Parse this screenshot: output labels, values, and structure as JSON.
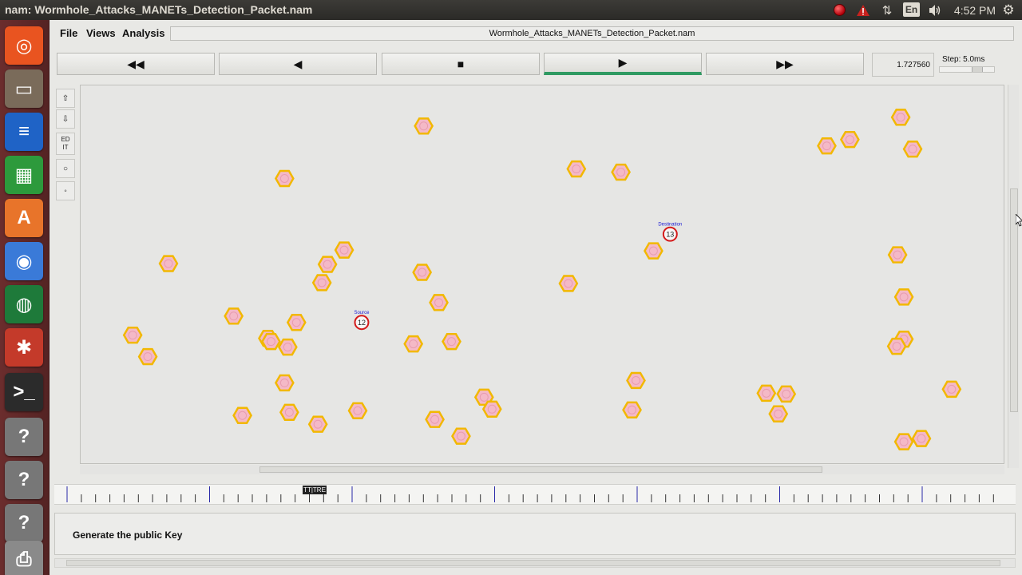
{
  "window": {
    "title": "nam: Wormhole_Attacks_MANETs_Detection_Packet.nam"
  },
  "tray": {
    "lang": "En",
    "clock": "4:52 PM",
    "recording_color": "#c4000e"
  },
  "launcher": {
    "items": [
      {
        "name": "ubuntu-dash-icon",
        "glyph": "◎",
        "color": "#e95420"
      },
      {
        "name": "files-icon",
        "glyph": "▭",
        "color": "#7a6b5a"
      },
      {
        "name": "writer-icon",
        "glyph": "≡",
        "color": "#1f63c6"
      },
      {
        "name": "calc-icon",
        "glyph": "▦",
        "color": "#2d9a3c"
      },
      {
        "name": "software-center-icon",
        "glyph": "A",
        "color": "#e8742a"
      },
      {
        "name": "chromium-icon",
        "glyph": "◉",
        "color": "#3a7ad8"
      },
      {
        "name": "globe-icon",
        "glyph": "◍",
        "color": "#1e7a3a"
      },
      {
        "name": "settings-icon",
        "glyph": "✱",
        "color": "#c43a2a"
      },
      {
        "name": "terminal-icon",
        "glyph": ">_",
        "color": "#2b2b2b"
      },
      {
        "name": "unknown-app-icon",
        "glyph": "?",
        "color": "#777777"
      },
      {
        "name": "unknown-app-icon",
        "glyph": "?",
        "color": "#777777"
      },
      {
        "name": "unknown-app-icon",
        "glyph": "?",
        "color": "#777777"
      },
      {
        "name": "printer-icon",
        "glyph": "⎙",
        "color": "#8a8a8a"
      }
    ]
  },
  "menu": {
    "file": "File",
    "views": "Views",
    "analysis": "Analysis",
    "file_title": "Wormhole_Attacks_MANETs_Detection_Packet.nam"
  },
  "controls": {
    "rewind": "◀◀",
    "back": "◀",
    "stop": "■",
    "play": "▶",
    "fast_forward": "▶▶",
    "time": "1.727560",
    "step": "Step: 5.0ms"
  },
  "tools": {
    "edit": "ED\nIT"
  },
  "timeline": {
    "marker_label": "TT|TRE"
  },
  "annotation": {
    "text": "Generate the public Key"
  },
  "nodes": {
    "source": {
      "label": "Source",
      "id": "12"
    },
    "destination": {
      "label": "Destination",
      "id": "13"
    }
  },
  "colors": {
    "node_stroke": "#f2b800",
    "node_fill": "#f4b9c7",
    "special_node": "#d41a1a",
    "special_label": "#1a1ad4",
    "play_active": "#2f9a62"
  }
}
